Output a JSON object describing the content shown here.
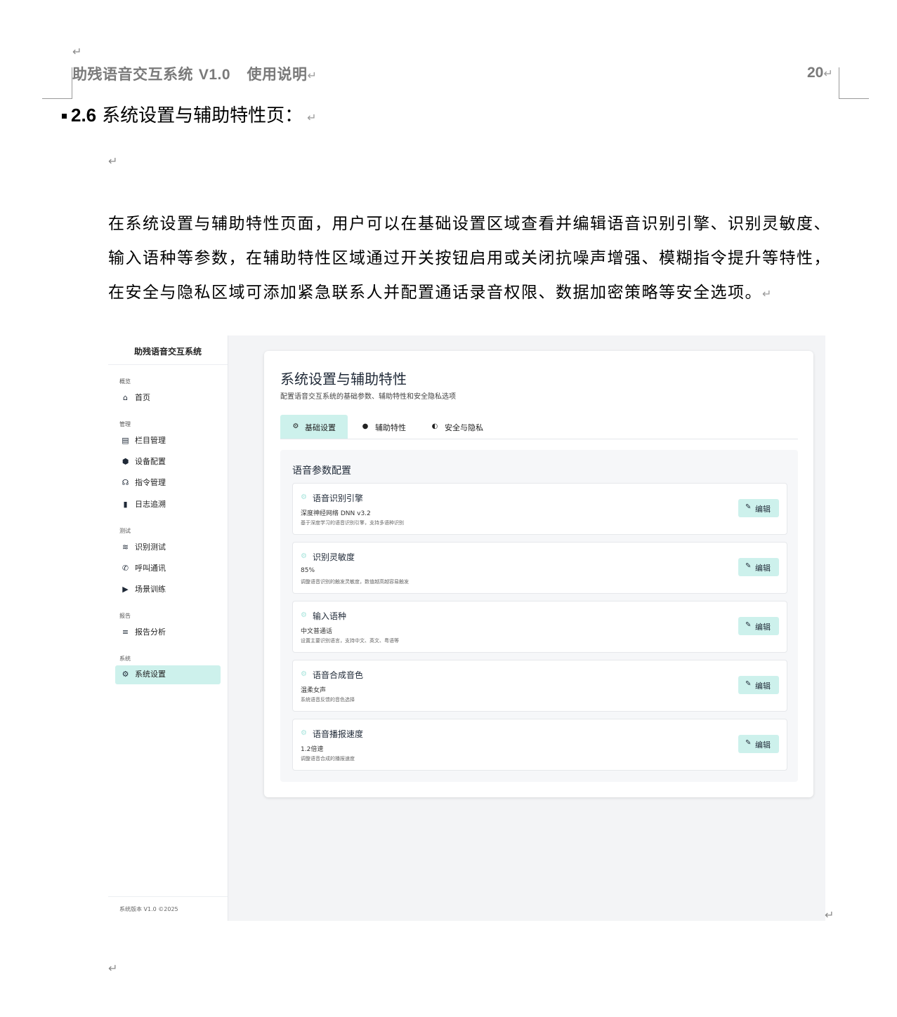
{
  "document": {
    "header_title_text": "助残语音交互系统",
    "header_title_version": "V1.0",
    "header_title_suffix": "使用说明",
    "page_number": "20",
    "section_number": "2.6",
    "section_title": "系统设置与辅助特性页：",
    "paragraph": "在系统设置与辅助特性页面，用户可以在基础设置区域查看并编辑语音识别引擎、识别灵敏度、输入语种等参数，在辅助特性区域通过开关按钮启用或关闭抗噪声增强、模糊指令提升等特性，在安全与隐私区域可添加紧急联系人并配置通话录音权限、数据加密策略等安全选项。",
    "return_mark": "↵"
  },
  "app": {
    "sidebar": {
      "title": "助残语音交互系统",
      "groups": [
        {
          "label": "概览",
          "items": [
            {
              "label": "首页",
              "icon": "home-icon"
            }
          ]
        },
        {
          "label": "管理",
          "items": [
            {
              "label": "栏目管理",
              "icon": "table-icon"
            },
            {
              "label": "设备配置",
              "icon": "cube-icon"
            },
            {
              "label": "指令管理",
              "icon": "microphone-icon"
            },
            {
              "label": "日志追溯",
              "icon": "file-icon"
            }
          ]
        },
        {
          "label": "测试",
          "items": [
            {
              "label": "识别测试",
              "icon": "wave-icon"
            },
            {
              "label": "呼叫通讯",
              "icon": "phone-icon"
            },
            {
              "label": "场景训练",
              "icon": "play-icon"
            }
          ]
        },
        {
          "label": "报告",
          "items": [
            {
              "label": "报告分析",
              "icon": "chart-icon"
            }
          ]
        },
        {
          "label": "系统",
          "items": [
            {
              "label": "系统设置",
              "icon": "gear-icon",
              "active": true
            }
          ]
        }
      ],
      "footer": "系统版本 V1.0 ©2025"
    },
    "main": {
      "title": "系统设置与辅助特性",
      "subtitle": "配置语音交互系统的基础参数、辅助特性和安全隐私选项",
      "tabs": [
        {
          "label": "基础设置",
          "icon": "gear-icon",
          "active": true
        },
        {
          "label": "辅助特性",
          "icon": "accessibility-icon"
        },
        {
          "label": "安全与隐私",
          "icon": "shield-icon"
        }
      ],
      "panel_title": "语音参数配置",
      "edit_label": "编辑",
      "settings": [
        {
          "name": "语音识别引擎",
          "value": "深度神经网络 DNN v3.2",
          "desc": "基于深度学习的语音识别引擎，支持多语种识别"
        },
        {
          "name": "识别灵敏度",
          "value": "85%",
          "desc": "调整语音识别的触发灵敏度，数值越高越容易触发"
        },
        {
          "name": "输入语种",
          "value": "中文普通话",
          "desc": "设置主要识别语言，支持中文、英文、粤语等"
        },
        {
          "name": "语音合成音色",
          "value": "温柔女声",
          "desc": "系统语音反馈的音色选择"
        },
        {
          "name": "语音播报速度",
          "value": "1.2倍速",
          "desc": "调整语音合成的播报速度"
        }
      ]
    }
  }
}
